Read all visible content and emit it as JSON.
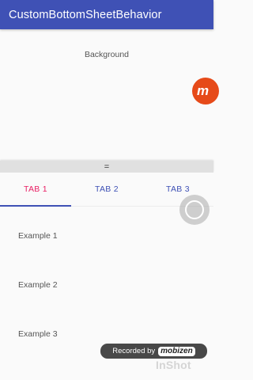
{
  "app_bar": {
    "title": "CustomBottomSheetBehavior"
  },
  "background": {
    "label": "Background"
  },
  "sheet_handle": {
    "label": "="
  },
  "tabs": [
    {
      "label": "TAB 1",
      "active": true
    },
    {
      "label": "TAB 2",
      "active": false
    },
    {
      "label": "TAB 3",
      "active": false
    }
  ],
  "list": {
    "items": [
      {
        "label": "Example 1"
      },
      {
        "label": "Example 2"
      },
      {
        "label": "Example 3"
      }
    ]
  },
  "overlays": {
    "mobizen_bubble_label": "m",
    "recorded_by_label": "Recorded by",
    "recorded_brand": "mobizen",
    "watermark": "InShot"
  },
  "colors": {
    "app_bar": "#3f51b5",
    "active_tab": "#e91e63",
    "tab_text": "#3f51b5",
    "indicator": "#3f51b5",
    "mobizen_bubble": "#e64a19"
  }
}
